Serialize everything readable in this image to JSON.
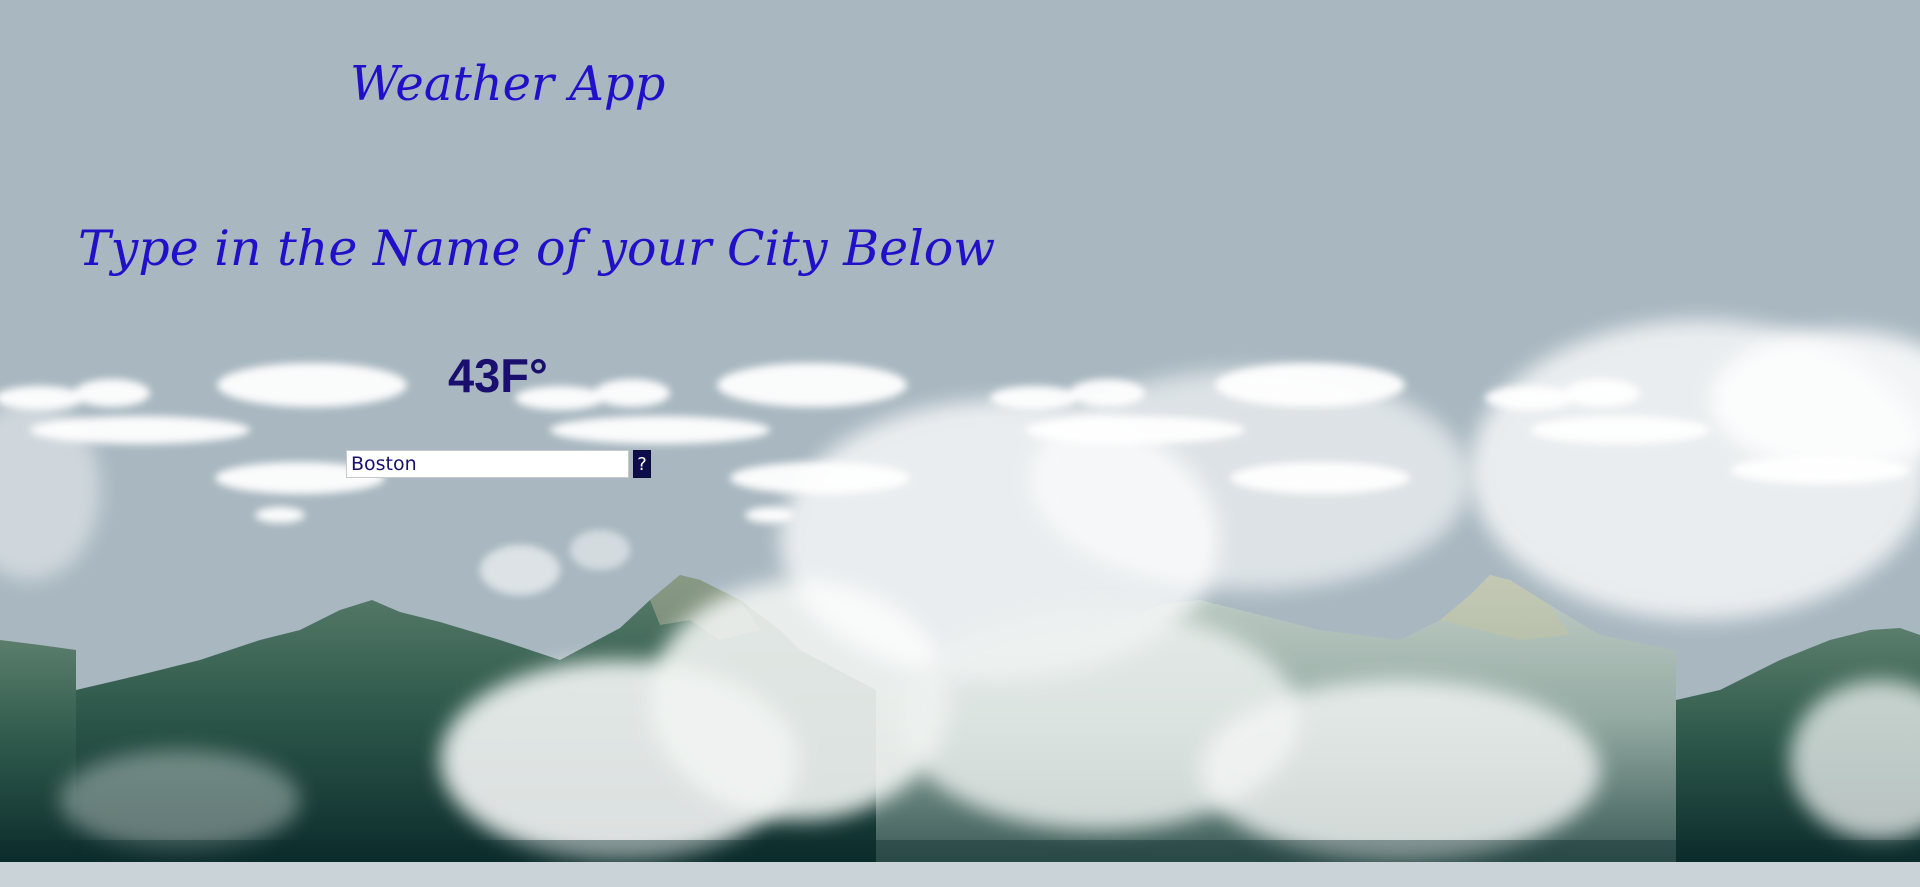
{
  "header": {
    "title": "Weather App"
  },
  "instructions": {
    "text": "Type in the Name of your City Below"
  },
  "weather": {
    "temperature": "43F°"
  },
  "search": {
    "value": "Boston",
    "button_label": "?"
  },
  "colors": {
    "background_sky": "#a8b7c0",
    "heading_text": "#2210c9",
    "temperature_text": "#1a0f6e",
    "button_background": "#0d0d4a"
  }
}
